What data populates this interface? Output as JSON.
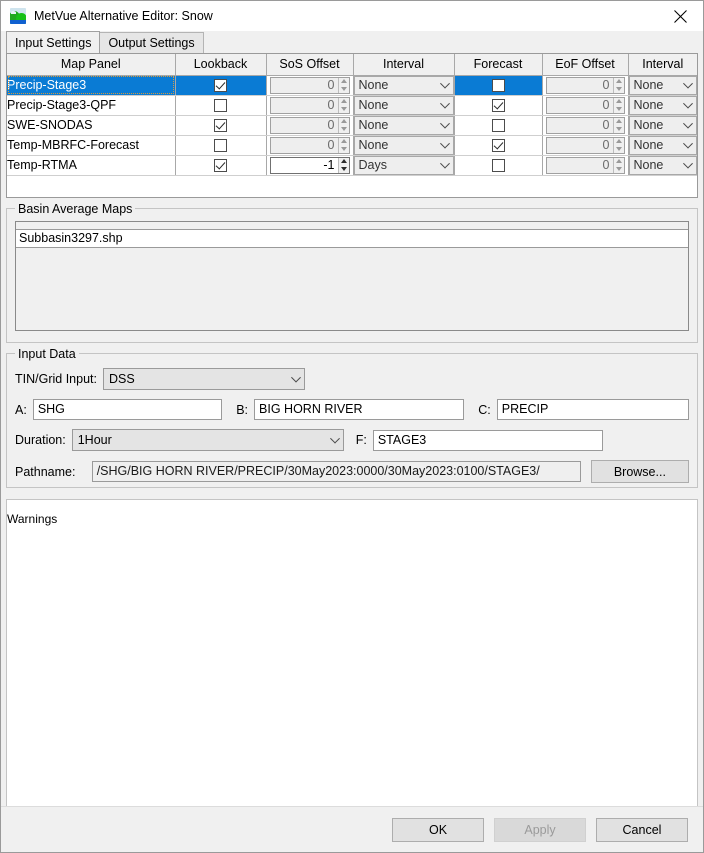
{
  "window": {
    "title": "MetVue Alternative Editor: Snow",
    "icon": "map-terrain-icon",
    "close_label": "close-icon"
  },
  "tabs": [
    {
      "label": "Input Settings",
      "active": true
    },
    {
      "label": "Output Settings",
      "active": false
    }
  ],
  "table": {
    "columns": [
      "Map Panel",
      "Lookback",
      "SoS Offset",
      "Interval",
      "Forecast",
      "EoF Offset",
      "Interval"
    ],
    "rows": [
      {
        "name": "Precip-Stage3",
        "selected": true,
        "lookback": true,
        "sos_offset": "0",
        "sos_enabled": false,
        "sos_interval": "None",
        "forecast": false,
        "eof_offset": "0",
        "eof_enabled": false,
        "eof_interval": "None"
      },
      {
        "name": "Precip-Stage3-QPF",
        "selected": false,
        "lookback": false,
        "sos_offset": "0",
        "sos_enabled": false,
        "sos_interval": "None",
        "forecast": true,
        "eof_offset": "0",
        "eof_enabled": false,
        "eof_interval": "None"
      },
      {
        "name": "SWE-SNODAS",
        "selected": false,
        "lookback": true,
        "sos_offset": "0",
        "sos_enabled": false,
        "sos_interval": "None",
        "forecast": false,
        "eof_offset": "0",
        "eof_enabled": false,
        "eof_interval": "None"
      },
      {
        "name": "Temp-MBRFC-Forecast",
        "selected": false,
        "lookback": false,
        "sos_offset": "0",
        "sos_enabled": false,
        "sos_interval": "None",
        "forecast": true,
        "eof_offset": "0",
        "eof_enabled": false,
        "eof_interval": "None"
      },
      {
        "name": "Temp-RTMA",
        "selected": false,
        "lookback": true,
        "sos_offset": "-1",
        "sos_enabled": true,
        "sos_interval": "Days",
        "forecast": false,
        "eof_offset": "0",
        "eof_enabled": false,
        "eof_interval": "None"
      }
    ]
  },
  "basin_average_maps": {
    "title": "Basin Average Maps",
    "items": [
      "Subbasin3297.shp"
    ]
  },
  "input_data": {
    "title": "Input Data",
    "tin_grid_label": "TIN/Grid Input:",
    "tin_grid_value": "DSS",
    "a_label": "A:",
    "a_value": "SHG",
    "b_label": "B:",
    "b_value": "BIG HORN RIVER",
    "c_label": "C:",
    "c_value": "PRECIP",
    "duration_label": "Duration:",
    "duration_value": "1Hour",
    "f_label": "F:",
    "f_value": "STAGE3",
    "pathname_label": "Pathname:",
    "pathname_value": "/SHG/BIG HORN RIVER/PRECIP/30May2023:0000/30May2023:0100/STAGE3/",
    "browse_label": "Browse..."
  },
  "warnings": {
    "title": "Warnings",
    "items": []
  },
  "buttons": {
    "ok": "OK",
    "apply": "Apply",
    "cancel": "Cancel",
    "apply_disabled": true
  },
  "colors": {
    "selection": "#0a7bd4",
    "window_bg": "#f0f0f0",
    "field_bg": "#ffffff"
  }
}
